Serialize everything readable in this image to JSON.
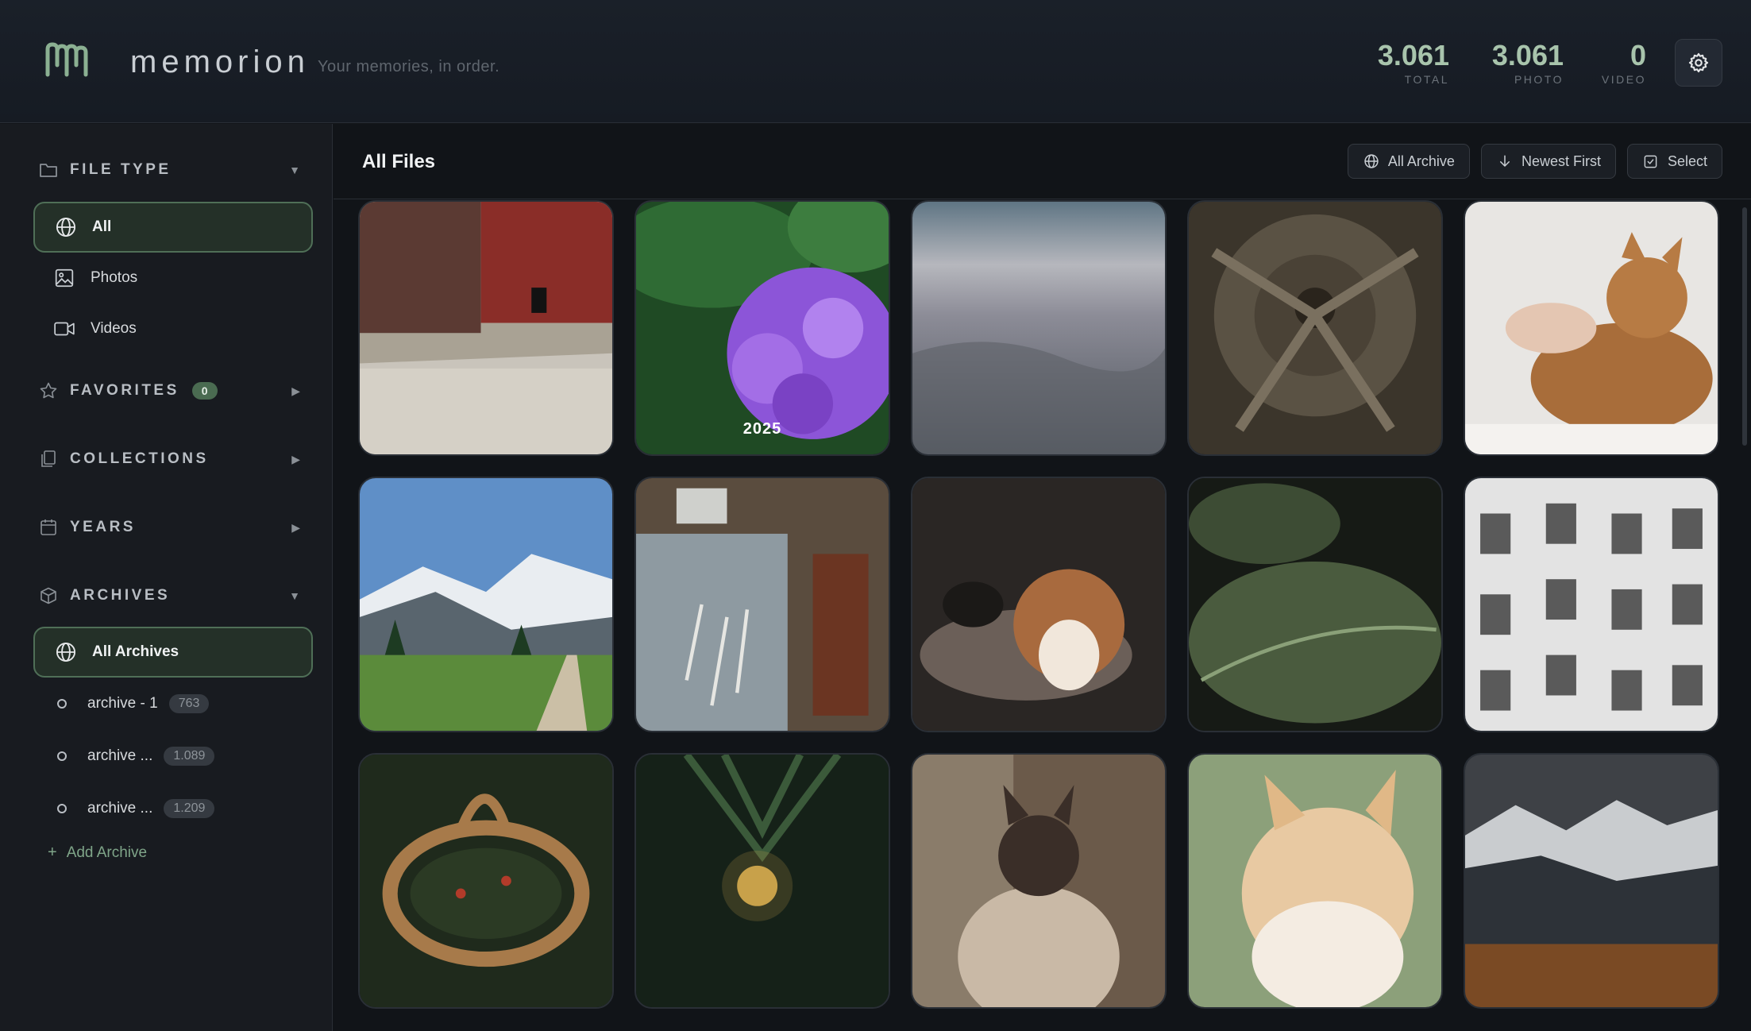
{
  "header": {
    "app_name": "memorion",
    "tagline": "Your memories, in order.",
    "stats": [
      {
        "value": "3.061",
        "label": "TOTAL"
      },
      {
        "value": "3.061",
        "label": "PHOTO"
      },
      {
        "value": "0",
        "label": "VIDEO"
      }
    ],
    "settings_icon": "gear-icon",
    "accent_color": "#a8c4ac"
  },
  "sidebar": {
    "file_type": {
      "title": "FILE TYPE",
      "icon": "folder-icon",
      "items": [
        {
          "label": "All",
          "icon": "globe-icon",
          "active": true
        },
        {
          "label": "Photos",
          "icon": "image-icon",
          "active": false
        },
        {
          "label": "Videos",
          "icon": "video-icon",
          "active": false
        }
      ]
    },
    "favorites": {
      "title": "FAVORITES",
      "count": "0",
      "icon": "star-icon"
    },
    "collections": {
      "title": "COLLECTIONS",
      "icon": "collections-icon"
    },
    "years": {
      "title": "YEARS",
      "icon": "calendar-icon"
    },
    "archives": {
      "title": "ARCHIVES",
      "icon": "box-icon",
      "all_label": "All Archives",
      "items": [
        {
          "label": "archive - 1",
          "count": "763"
        },
        {
          "label": "archive ...",
          "count": "1.089"
        },
        {
          "label": "archive ...",
          "count": "1.209"
        }
      ],
      "add_label": "Add Archive"
    }
  },
  "main": {
    "title": "All Files",
    "toolbar": {
      "archive_filter": "All Archive",
      "sort": "Newest First",
      "select": "Select"
    },
    "tiles": [
      {
        "subject": "black cat by red barn",
        "year": ""
      },
      {
        "subject": "purple hydrangea",
        "year": "2025"
      },
      {
        "subject": "aerial view from plane",
        "year": ""
      },
      {
        "subject": "pine cone close-up",
        "year": ""
      },
      {
        "subject": "hand petting cat",
        "year": ""
      },
      {
        "subject": "mountain trail",
        "year": ""
      },
      {
        "subject": "old shop entrance",
        "year": ""
      },
      {
        "subject": "fluffy cat on bed",
        "year": ""
      },
      {
        "subject": "hosta leaf with drops",
        "year": ""
      },
      {
        "subject": "building windows",
        "year": ""
      },
      {
        "subject": "wicker basket",
        "year": ""
      },
      {
        "subject": "pine branch ornament",
        "year": ""
      },
      {
        "subject": "siamese cat at window",
        "year": ""
      },
      {
        "subject": "orange cat looking up",
        "year": ""
      },
      {
        "subject": "snowy mountain valley",
        "year": ""
      }
    ]
  }
}
